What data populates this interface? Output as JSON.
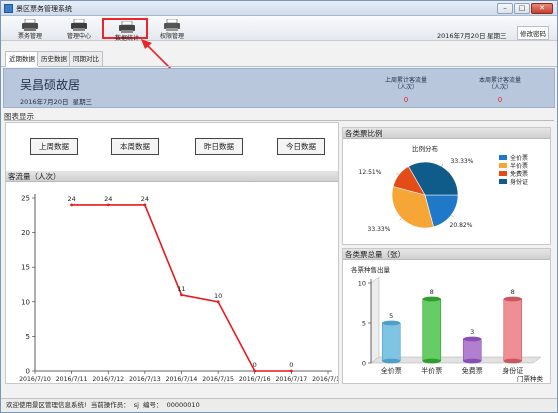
{
  "window": {
    "title": "景区票务管理系统",
    "min": "–",
    "max": "□",
    "close": "✕"
  },
  "toolbar": {
    "buttons": [
      {
        "label": "票务管理",
        "icon": "ticket-printer-icon"
      },
      {
        "label": "管理中心",
        "icon": "printer-icon"
      },
      {
        "label": "数据统计",
        "icon": "statistics-printer-icon"
      },
      {
        "label": "权限管理",
        "icon": "permission-printer-icon"
      }
    ],
    "date": "2016年7月20日",
    "weekday": "星期三",
    "change_password": "修改密码"
  },
  "tabs": [
    "近期数据",
    "历史数据",
    "同期对比"
  ],
  "header": {
    "site_name": "吴昌硕故居",
    "date": "2016年7月20日",
    "weekday": "星期三",
    "last_week_label_1": "上周累计客流量",
    "last_week_label_2": "（人次）",
    "last_week_value": "0",
    "this_week_label_1": "本周累计客流量",
    "this_week_label_2": "（人次）",
    "this_week_value": "0"
  },
  "section_title": "图表显示",
  "query_buttons": [
    "上周数据",
    "本周数据",
    "昨日数据",
    "今日数据"
  ],
  "line_panel_title": "客流量（人次）",
  "pie_panel_title": "各类票比例",
  "bar_panel_title": "各类票总量（张）",
  "status": {
    "welcome": "欢迎使用景区管理信息系统!",
    "operator_label": "当前操作员：",
    "operator": "sj",
    "id_label": "编号：",
    "id": "00000010"
  },
  "colors": {
    "line": "#e8191c",
    "full": "#1f78c8",
    "half": "#f5a637",
    "free": "#e34c17",
    "id": "#0f5b8a",
    "highlight": "#e8262b"
  },
  "chart_data": [
    {
      "type": "line",
      "title": "客流量（人次）",
      "x": [
        "2016/7/10",
        "2016/7/11",
        "2016/7/12",
        "2016/7/13",
        "2016/7/14",
        "2016/7/15",
        "2016/7/16",
        "2016/7/17",
        "2016/7/18"
      ],
      "series": [
        {
          "x": [
            "2016/7/11",
            "2016/7/12",
            "2016/7/13",
            "2016/7/14",
            "2016/7/15",
            "2016/7/16",
            "2016/7/17"
          ],
          "values": [
            24,
            24,
            24,
            11,
            10,
            0,
            0
          ]
        }
      ],
      "yticks": [
        0,
        5,
        10,
        15,
        20,
        25
      ],
      "ylim": [
        0,
        25
      ],
      "grid": false,
      "data_labels": [
        "24",
        "24",
        "24",
        "11",
        "10",
        "0",
        "0"
      ]
    },
    {
      "type": "pie",
      "title": "比例分布",
      "slices": [
        {
          "name": "全价票",
          "value": 20.82
        },
        {
          "name": "半价票",
          "value": 33.33
        },
        {
          "name": "免费票",
          "value": 12.51
        },
        {
          "name": "身份证",
          "value": 33.33
        }
      ],
      "labels": [
        "20.82%",
        "33.33%",
        "12.51%",
        "33.33%"
      ],
      "legend": "right"
    },
    {
      "type": "bar",
      "title": "各票种售出量",
      "categories": [
        "全价票",
        "半价票",
        "免费票",
        "身份证"
      ],
      "values": [
        5,
        8,
        3,
        8
      ],
      "xlabel": "门票种类",
      "yticks": [
        0,
        5,
        10
      ],
      "ylim": [
        0,
        10
      ]
    }
  ]
}
